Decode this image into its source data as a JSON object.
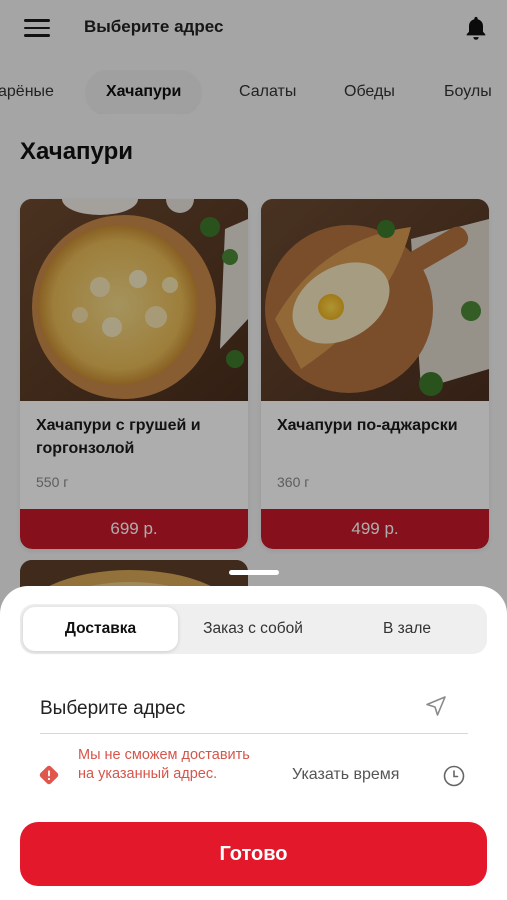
{
  "header": {
    "title": "Выберите адрес"
  },
  "categories": {
    "tabs": [
      "арёные",
      "Хачапури",
      "Салаты",
      "Обеды",
      "Боулы"
    ],
    "active": "Хачапури"
  },
  "section": {
    "title": "Хачапури"
  },
  "products": [
    {
      "name": "Хачапури с грушей и горгонзолой",
      "weight": "550 г",
      "price": "699 р."
    },
    {
      "name": "Хачапури по-аджарски",
      "weight": "360 г",
      "price": "499 р."
    }
  ],
  "sheet": {
    "modes": [
      "Доставка",
      "Заказ с собой",
      "В зале"
    ],
    "active_mode": "Доставка",
    "address_placeholder": "Выберите адрес",
    "warning": "Мы не сможем доставить на указанный адрес.",
    "time_label": "Указать время",
    "done_label": "Готово"
  },
  "colors": {
    "accent": "#e3182a",
    "price_bar": "#c8192b",
    "warning_text": "#d6554b",
    "warning_icon": "#e0554c"
  }
}
